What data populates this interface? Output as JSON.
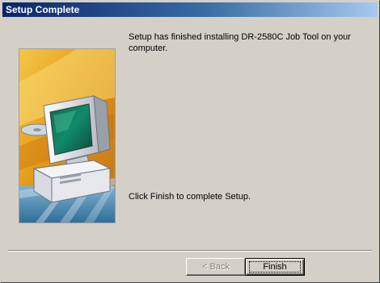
{
  "window": {
    "title": "Setup Complete"
  },
  "main": {
    "message": "Setup has finished installing DR-2580C Job Tool on your computer.",
    "instruction": "Click Finish to complete Setup."
  },
  "buttons": {
    "back_label": "< Back",
    "finish_label": "Finish"
  },
  "graphic": {
    "icon": "computer-setup-illustration-icon"
  },
  "colors": {
    "titlebar_start": "#0a246a",
    "titlebar_end": "#a6caf0",
    "dialog_face": "#d4d0c8"
  }
}
